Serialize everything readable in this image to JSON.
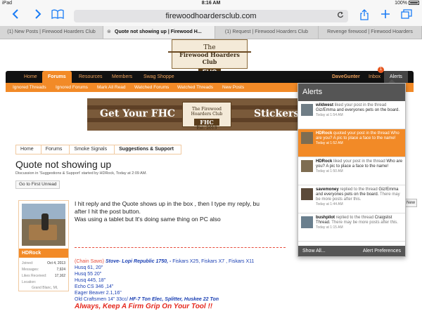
{
  "status_bar": {
    "device": "iPad",
    "time": "8:16 AM",
    "battery": "100%"
  },
  "browser": {
    "back_icon": "chevron-left-icon",
    "forward_icon": "chevron-right-icon",
    "bookmarks_icon": "book-icon",
    "url": "firewoodhoardersclub.com",
    "reload_icon": "reload-icon",
    "share_icon": "share-icon",
    "new_tab_icon": "plus-icon",
    "tabs_icon": "tabs-icon"
  },
  "tabs": [
    {
      "title": "(1) New Posts | Firewood Hoarders Club"
    },
    {
      "title": "Quote not showing up | Firewood H..."
    },
    {
      "title": "(1) Request | Firewood Hoarders Club"
    },
    {
      "title": "Revenge firewood | Firewood Hoarders"
    }
  ],
  "logo": {
    "line1": "The",
    "line2": "Firewood Hoarders Club",
    "badge": "FHC"
  },
  "nav": {
    "items": [
      "Home",
      "Forums",
      "Resources",
      "Members",
      "Swag Shoppe"
    ],
    "user": "DaveGunter",
    "inbox": "Inbox",
    "inbox_count": "1",
    "alerts": "Alerts"
  },
  "subnav": [
    "Ignored Threads",
    "Ignored Forums",
    "Mark All Read",
    "Watched Forums",
    "Watched Threads",
    "New Posts"
  ],
  "banner": {
    "left": "Get Your FHC",
    "right": "Stickers",
    "mini_top": "The Firewood Hoarders Club",
    "mini_badge": "FHC",
    "mini_est": "Est. 2013"
  },
  "breadcrumb": [
    "Home",
    "Forums",
    "Smoke Signals",
    "Suggestions & Support"
  ],
  "thread": {
    "title": "Quote not showing up",
    "meta": "Discussion in 'Suggestions & Support' started by HDRock, Today at 2:09 AM.",
    "go_unread": "Go to First Unread"
  },
  "post": {
    "author": "HDRock",
    "stats": [
      {
        "label": "Joined:",
        "value": "Oct 4, 2013"
      },
      {
        "label": "Messages:",
        "value": "7,924"
      },
      {
        "label": "Likes Received:",
        "value": "17,162"
      },
      {
        "label": "Location:",
        "value": ""
      },
      {
        "label": "",
        "value": "Grand Blanc, MI,"
      }
    ],
    "body": [
      "I hit reply and the Quote shows up in the box , then I type my reply, bu",
      "after I hit the post button.",
      "Was using a tablet but It's doing same thing on PC also"
    ],
    "signature": {
      "line1_red": "(Chain Saws) ",
      "line1_blue": "Stove- Lopi Republic 1750, - ",
      "line1_rest": "Fiskars X25, Fiskars X7 , Fiskars X11",
      "lines": [
        "Husq 61, 20\"",
        "Husq 55 20\"",
        "Husq 445, 18\"",
        "Echo CS 346 ,14\"",
        "Eager Beaver 2.1,16\""
      ],
      "craftsmen": "Old Craftsmen 14\" 33cc/ ",
      "craftsmen_rest": "HF-7 Ton Elec, Splitter, Huskee 22 Ton",
      "motto": "Always, Keep A Firm Grip On Your Tool !!"
    }
  },
  "alerts": {
    "title": "Alerts",
    "items": [
      {
        "user": "wildwest",
        "action": " liked your post in the thread ",
        "thread": "Giz/Emma and everyones pets on the board.",
        "more": "",
        "time": "Today at 1:54 AM",
        "highlight": false
      },
      {
        "user": "HDRock",
        "action": " quoted your post in the thread ",
        "thread": "Who are you? A pic to place a face to the name!",
        "more": "",
        "time": "Today at 1:52 AM",
        "highlight": true
      },
      {
        "user": "HDRock",
        "action": " liked your post in the thread ",
        "thread": "Who are you? A pic to place a face to the name!",
        "more": "",
        "time": "Today at 1:50 AM",
        "highlight": false
      },
      {
        "user": "savemoney",
        "action": " replied to the thread ",
        "thread": "Giz/Emma and everyones pets on the board.",
        "more": " There may be more posts after this.",
        "time": "Today at 1:44 AM",
        "highlight": false
      },
      {
        "user": "bushpilot",
        "action": " replied to the thread ",
        "thread": "Craigslist Thread.",
        "more": " There may be more posts after this.",
        "time": "Today at 1:15 AM",
        "highlight": false
      }
    ],
    "show_all": "Show All...",
    "preferences": "Alert Preferences"
  },
  "new_button": "New"
}
